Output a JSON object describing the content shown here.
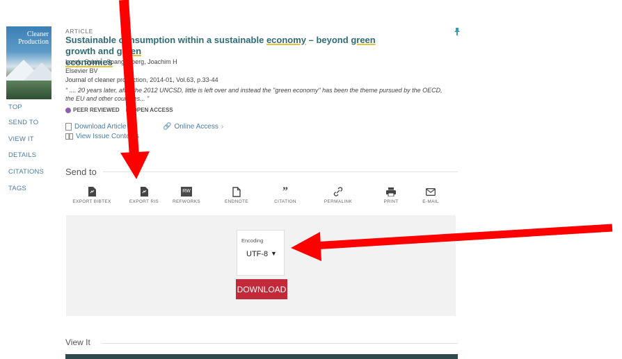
{
  "record": {
    "type_label": "ARTICLE",
    "title_part1": "Sustainable consumption within a sustainable ",
    "title_hl1": "economy",
    "title_part2": " – beyond ",
    "title_hl2": "green",
    "title_part3": " growth and ",
    "title_hl3": "green",
    "title_hl4": "economies",
    "authors": "Lorek, Sylvia ; Spangenberg, Joachim H",
    "publisher": "Elsevier BV",
    "source": "Journal of cleaner production, 2014-01, Vol.63, p.33-44",
    "snippet": "“ .... 20 years later, after the 2012 UNCSD, little is left over and instead the \"green economy\" has been the theme pursued by the OECD, the EU and other countries... ”",
    "badge_peer": "PEER REVIEWED",
    "badge_open": "OPEN ACCESS",
    "cover_text": "Cleaner Production"
  },
  "links": {
    "download_article": "Download Article",
    "online_access": "Online Access",
    "view_issue": "View Issue Contents"
  },
  "sidebar": {
    "items": [
      {
        "label": "TOP"
      },
      {
        "label": "SEND TO"
      },
      {
        "label": "VIEW IT"
      },
      {
        "label": "DETAILS"
      },
      {
        "label": "CITATIONS"
      },
      {
        "label": "TAGS"
      }
    ]
  },
  "send_to": {
    "heading": "Send to",
    "actions": [
      {
        "label": "EXPORT BIBTEX",
        "icon": "file-icon"
      },
      {
        "label": "EXPORT RIS",
        "icon": "file-icon"
      },
      {
        "label": "REFWORKS",
        "icon": "refworks-icon"
      },
      {
        "label": "ENDNOTE",
        "icon": "document-icon"
      },
      {
        "label": "CITATION",
        "icon": "quote-icon"
      },
      {
        "label": "PERMALINK",
        "icon": "link-icon"
      },
      {
        "label": "PRINT",
        "icon": "printer-icon"
      },
      {
        "label": "E-MAIL",
        "icon": "mail-icon"
      }
    ],
    "encoding_label": "Encoding",
    "encoding_value": "UTF-8",
    "download_label": "DOWNLOAD"
  },
  "view_it": {
    "heading": "View It"
  },
  "colors": {
    "title": "#2f6b74",
    "link": "#4b7aa3",
    "download_button": "#c22a3a",
    "annotation_arrow": "#ff0000"
  }
}
